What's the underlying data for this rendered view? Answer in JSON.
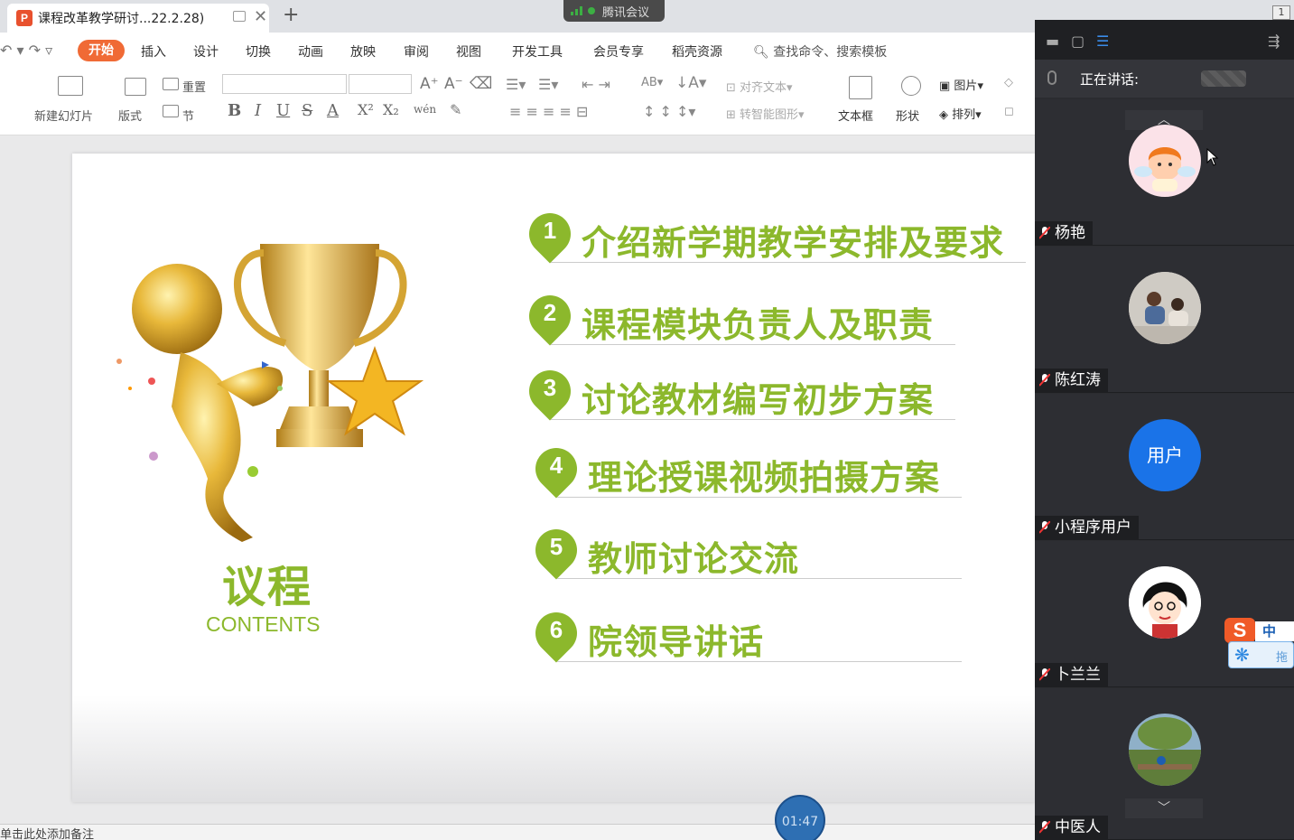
{
  "titlebar": {
    "tab_title": "课程改革教学研讨...22.2.28)",
    "tab_logo": "P",
    "add_tab": "+",
    "close_tab": "✕",
    "meeting_app": "腾讯会议",
    "window_num": "1"
  },
  "menu": {
    "items": [
      "开始",
      "插入",
      "设计",
      "切换",
      "动画",
      "放映",
      "审阅",
      "视图",
      "开发工具",
      "会员专享",
      "稻壳资源"
    ],
    "search": "查找命令、搜索模板"
  },
  "ribbon": {
    "new_slide": "新建幻灯片",
    "layout": "版式",
    "reset": "重置",
    "section": "节",
    "align_text": "对齐文本",
    "smart_art": "转智能图形",
    "textbox": "文本框",
    "shape": "形状",
    "picture": "图片",
    "arrange": "排列",
    "fmt_bold": "B",
    "fmt_italic": "I",
    "fmt_underline": "U",
    "fmt_strike": "S",
    "fmt_color": "A",
    "fmt_sup": "X²",
    "fmt_sub": "X₂",
    "fmt_pinyin": "wén",
    "fmt_grow": "A⁺",
    "fmt_shrink": "A⁻"
  },
  "slide": {
    "contents_title": "议程",
    "contents_sub": "CONTENTS",
    "agenda": [
      {
        "num": "1",
        "text": "介绍新学期教学安排及要求"
      },
      {
        "num": "2",
        "text": "课程模块负责人及职责"
      },
      {
        "num": "3",
        "text": "讨论教材编写初步方案"
      },
      {
        "num": "4",
        "text": "理论授课视频拍摄方案"
      },
      {
        "num": "5",
        "text": "教师讨论交流"
      },
      {
        "num": "6",
        "text": "院领导讲话"
      }
    ]
  },
  "notes": "单击此处添加备注",
  "timer": "01:47",
  "panel": {
    "speaking_label": "正在讲话:",
    "participants": [
      {
        "name": "杨艳",
        "avatar": "cartoon-angel"
      },
      {
        "name": "陈红涛",
        "avatar": "family-photo"
      },
      {
        "name": "小程序用户",
        "avatar": "用户"
      },
      {
        "name": "卜兰兰",
        "avatar": "cartoon-girl"
      },
      {
        "name": "中医人",
        "avatar": "scenery-photo"
      }
    ]
  },
  "ime": {
    "label": "中",
    "drag": "拖"
  },
  "colors": {
    "accent_green": "#8cb82c",
    "wps_orange": "#f06a35",
    "panel_bg": "#2b2c30",
    "user_blue": "#1a73e8"
  }
}
